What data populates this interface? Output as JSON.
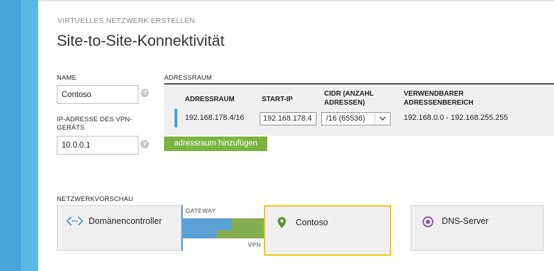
{
  "header": {
    "subtitle": "VIRTUELLES NETZWERK ERSTELLEN",
    "title": "Site-to-Site-Konnektivität"
  },
  "form": {
    "name_label": "NAME",
    "name_value": "Contoso",
    "vpn_label_line1": "IP-ADRESSE DES VPN-",
    "vpn_label_line2": "GERÄTS",
    "vpn_value": "10.0.0.1",
    "help_glyph": "?"
  },
  "address_space": {
    "heading": "ADRESSRAUM",
    "columns": {
      "adressraum": "ADRESSRAUM",
      "start_ip": "START-IP",
      "cidr_line1": "CIDR (ANZAHL",
      "cidr_line2": "ADRESSEN)",
      "usable_line1": "VERWENDBARER",
      "usable_line2": "ADRESSENBEREICH"
    },
    "row": {
      "adressraum": "192.168.178.4/16",
      "start_ip": "192.168.178.4",
      "cidr": "/16 (65536)",
      "usable": "192.168.0.0 - 192.168.255.255"
    },
    "add_button": "adressraum hinzufügen"
  },
  "preview": {
    "heading": "NETZWERKVORSCHAU",
    "domain_controller": "Domänencontroller",
    "gateway_label": "GATEWAY",
    "vpn_label": "VPN",
    "site_name": "Contoso",
    "dns_server": "DNS-Server"
  },
  "colors": {
    "accent_blue": "#47a6d9",
    "add_button_green": "#7bb342",
    "selection_yellow": "#f2c811",
    "dns_purple": "#7d4fa3",
    "location_green": "#5f8f3a"
  }
}
